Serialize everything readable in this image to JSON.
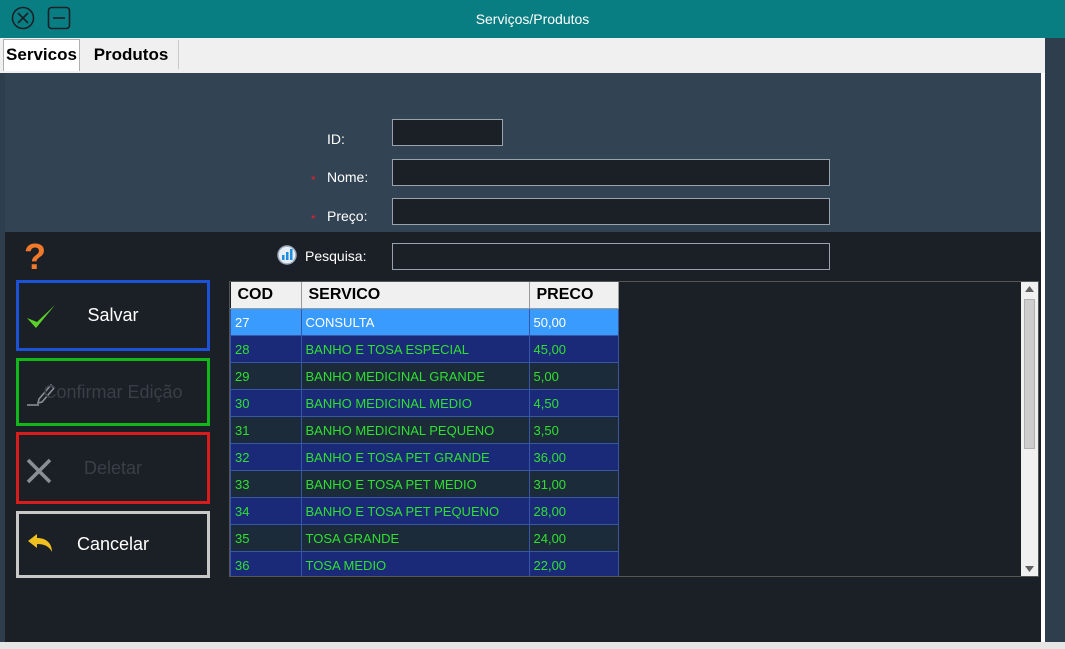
{
  "window": {
    "title": "Serviços/Produtos",
    "close_icon": "close-circle-icon",
    "minimize_icon": "minimize-box-icon"
  },
  "tabs": [
    {
      "label": "Servicos",
      "active": true
    },
    {
      "label": "Produtos",
      "active": false
    }
  ],
  "form": {
    "id_label": "ID:",
    "nome_label": "Nome:",
    "preco_label": "Preço:",
    "pesquisa_label": "Pesquisa:",
    "required_marker": "*",
    "id_value": "",
    "nome_value": "",
    "preco_value": "",
    "pesquisa_value": ""
  },
  "help_icon": "question-mark-icon",
  "help_text": "?",
  "buttons": {
    "salvar": {
      "label": "Salvar",
      "border_color": "#1c52d8",
      "text_color": "#ffffff"
    },
    "confirmar": {
      "label": "Confirmar Edição",
      "border_color": "#10b81c",
      "text_color": "#3a3f46"
    },
    "deletar": {
      "label": "Deletar",
      "border_color": "#d81c1c",
      "text_color": "#3a3f46"
    },
    "cancelar": {
      "label": "Cancelar",
      "border_color": "#c8c8c8",
      "text_color": "#ffffff"
    }
  },
  "table": {
    "columns": [
      "COD",
      "SERVICO",
      "PRECO"
    ],
    "rows": [
      [
        "27",
        "CONSULTA",
        "50,00"
      ],
      [
        "28",
        "BANHO E TOSA ESPECIAL",
        "45,00"
      ],
      [
        "29",
        "BANHO MEDICINAL GRANDE",
        "5,00"
      ],
      [
        "30",
        "BANHO MEDICINAL MEDIO",
        "4,50"
      ],
      [
        "31",
        "BANHO MEDICINAL PEQUENO",
        "3,50"
      ],
      [
        "32",
        "BANHO E TOSA PET GRANDE",
        "36,00"
      ],
      [
        "33",
        "BANHO E TOSA PET MEDIO",
        "31,00"
      ],
      [
        "34",
        "BANHO E TOSA PET PEQUENO",
        "28,00"
      ],
      [
        "35",
        "TOSA GRANDE",
        "24,00"
      ],
      [
        "36",
        "TOSA MEDIO",
        "22,00"
      ]
    ],
    "selected_index": 0
  },
  "colors": {
    "titlebar": "#087e83",
    "panel_top": "#324354",
    "panel_bottom": "#1b1f26",
    "row_text": "#2fe02f",
    "selected_row": "#3a9bff"
  }
}
